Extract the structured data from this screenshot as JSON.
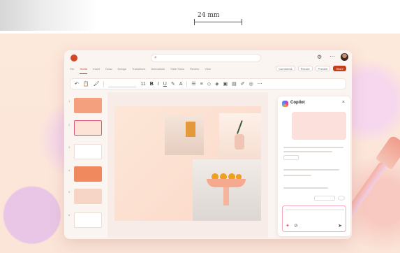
{
  "dimension_label": "24 mm",
  "window": {
    "search_placeholder": "",
    "tabs": [
      "File",
      "Home",
      "Insert",
      "Draw",
      "Design",
      "Transitions",
      "Animations",
      "Slide Show",
      "Review",
      "View"
    ],
    "active_tab_index": 1,
    "ribbon_pills": [
      "Comments",
      "Record",
      "Present",
      "Share"
    ],
    "toolbar": {
      "font_size": "11",
      "bold": "B",
      "italic": "I",
      "underline": "U"
    },
    "slide_numbers": [
      "1",
      "2",
      "3",
      "4",
      "5",
      "6"
    ],
    "colors": {
      "accent": "#c43e1c",
      "thumb_orange": "#f4a07e",
      "selection": "#e2557a"
    }
  },
  "copilot": {
    "title": "Copilot",
    "close_glyph": "×"
  }
}
